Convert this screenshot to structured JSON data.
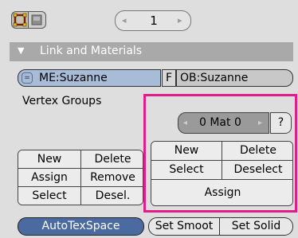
{
  "toolbar": {
    "view_icon": "mesh-view-icon",
    "render_icon": "image-icon",
    "number": "1",
    "left_arrow": "◂",
    "right_arrow": "▸"
  },
  "panel": {
    "collapse_icon": "▼",
    "title": "Link and Materials"
  },
  "link": {
    "mesh_browse_icon": "=",
    "mesh_name": "ME:Suzanne",
    "fake_user": "F",
    "object_name": "OB:Suzanne"
  },
  "vertex_groups": {
    "label": "Vertex Groups",
    "buttons": [
      [
        "New",
        "Delete"
      ],
      [
        "Assign",
        "Remove"
      ],
      [
        "Select",
        "Desel."
      ]
    ]
  },
  "materials": {
    "index_text": "0 Mat 0",
    "left_arrow": "◂",
    "right_arrow": "▸",
    "help": "?",
    "buttons": [
      [
        "New",
        "Delete"
      ],
      [
        "Select",
        "Deselect"
      ]
    ],
    "assign": "Assign"
  },
  "bottom": {
    "autotexspace": "AutoTexSpace",
    "set_smooth": "Set Smoot",
    "set_solid": "Set Solid"
  },
  "colors": {
    "highlight": "#e21c8a",
    "header": "#a9a9a9",
    "autotex": "#4b6a9f",
    "mesh_field": "#a8bcd8"
  }
}
